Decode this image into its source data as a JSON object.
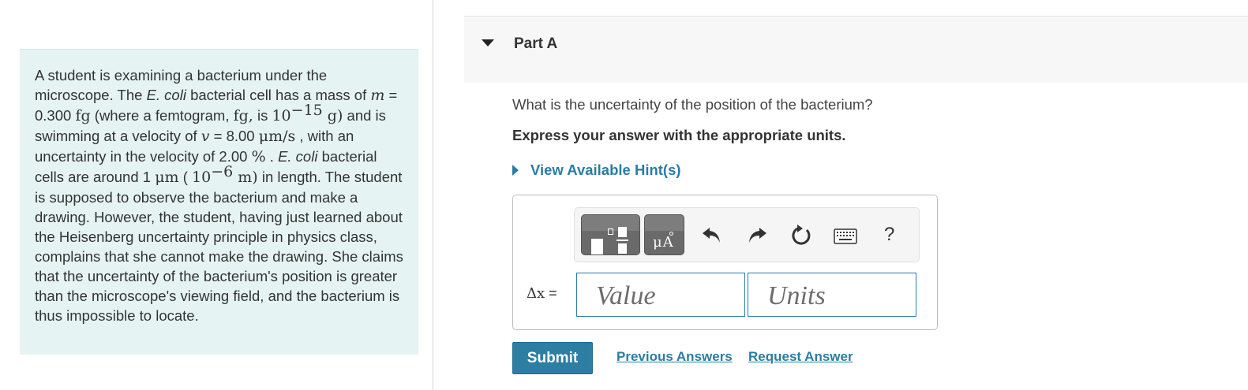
{
  "problem": {
    "s1": "A student is examining a bacterium under the microscope. The ",
    "s2": "E. coli",
    "s3": " bacterial cell has a mass of ",
    "m_var": "m",
    "s4": " = 0.300 ",
    "fg": "fg",
    "s5": " (where a femtogram, ",
    "fg2": "fg,",
    "s6": "  is ",
    "ten": "10",
    "exp15": "−15",
    "g": " g)",
    "s7": " and is swimming at a velocity of ",
    "v_var": "v",
    "s8": " = 8.00 ",
    "ums": "μm/s",
    "s9": " , with an uncertainty in the velocity of 2.00 ",
    "pct": "%",
    "s10": " . ",
    "s11": "E. coli",
    "s12": " bacterial cells are around 1 ",
    "um": "μm",
    "s13": " ( ",
    "ten2": "10",
    "exp6": "−6",
    "m_unit": " m)",
    "s14": " in length. The student is supposed to observe the bacterium and make a drawing. However, the student, having just learned about the Heisenberg uncertainty principle in physics class, complains that she cannot make the drawing. She claims that the uncertainty of the bacterium's position is greater than the microscope's viewing field, and the bacterium is thus impossible to locate."
  },
  "part": {
    "title": "Part A",
    "question": "What is the uncertainty of the position of the bacterium?",
    "instruction": "Express your answer with the appropriate units.",
    "hint_label": "View Available Hint(s)"
  },
  "answer": {
    "variable": "Δx",
    "equals": " =",
    "value_placeholder": "Value",
    "units_placeholder": "Units",
    "toolbar": {
      "unit_glyph": "μA",
      "help_label": "?",
      "icons": [
        "templates-icon",
        "units-icon",
        "undo-icon",
        "redo-icon",
        "reset-icon",
        "keyboard-icon",
        "help-icon"
      ]
    }
  },
  "actions": {
    "submit": "Submit",
    "previous_answers": "Previous Answers",
    "request_answer": "Request Answer"
  },
  "colors": {
    "intro_bg": "#e5f4f3",
    "accent": "#2d7ea3",
    "link": "#2a7da3",
    "header_bg": "#f7f7f7"
  }
}
